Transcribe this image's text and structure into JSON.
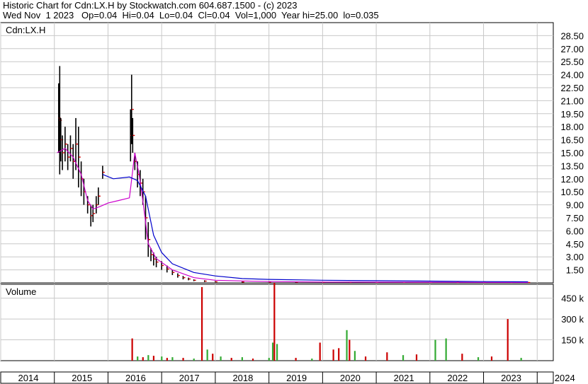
{
  "header": {
    "line1": "Historic Chart for Cdn:LX.H by Stockwatch.com 604.687.1500 - (c) 2023",
    "line2": "Wed Nov  1 2023   Op=0.04  Hi=0.04  Lo=0.04  Cl=0.04  Vol=1,000  Year hi=25.00  lo=0.035"
  },
  "colors": {
    "price_bar": "#000000",
    "close_tick": "#cc0000",
    "ma_short": "#cc00cc",
    "ma_long": "#0000cc",
    "volume_up": "#33aa33",
    "volume_down": "#cc0000",
    "grid": "#c8c8c8"
  },
  "chart_data": [
    {
      "type": "line",
      "title": "Cdn:LX.H",
      "x_range": [
        2014.0,
        2024.3
      ],
      "ylim": [
        0,
        30
      ],
      "y_ticks": [
        "1.50",
        "3.00",
        "4.50",
        "6.00",
        "7.50",
        "9.00",
        "10.50",
        "12.00",
        "13.50",
        "15.00",
        "16.50",
        "18.00",
        "19.50",
        "21.00",
        "22.50",
        "24.00",
        "25.50",
        "27.00",
        "28.50"
      ],
      "grid": true,
      "price_bars": [
        [
          2015.08,
          15,
          23
        ],
        [
          2015.1,
          12.5,
          25
        ],
        [
          2015.12,
          14,
          19
        ],
        [
          2015.15,
          13,
          17
        ],
        [
          2015.2,
          14,
          18
        ],
        [
          2015.25,
          13,
          16
        ],
        [
          2015.3,
          14,
          17
        ],
        [
          2015.35,
          12,
          16
        ],
        [
          2015.4,
          13,
          19
        ],
        [
          2015.45,
          11,
          18
        ],
        [
          2015.5,
          10,
          14
        ],
        [
          2015.55,
          9,
          12
        ],
        [
          2015.62,
          8,
          10
        ],
        [
          2015.68,
          6.5,
          9
        ],
        [
          2015.72,
          7,
          9
        ],
        [
          2015.78,
          8,
          10
        ],
        [
          2015.82,
          9,
          11
        ],
        [
          2015.9,
          12,
          13.5
        ],
        [
          2016.42,
          14,
          20
        ],
        [
          2016.44,
          16,
          24
        ],
        [
          2016.46,
          15,
          19
        ],
        [
          2016.5,
          13,
          15
        ],
        [
          2016.55,
          11,
          14
        ],
        [
          2016.6,
          10,
          13
        ],
        [
          2016.65,
          9,
          12
        ],
        [
          2016.7,
          5,
          10
        ],
        [
          2016.75,
          3,
          7
        ],
        [
          2016.8,
          2.5,
          4
        ],
        [
          2016.85,
          2,
          3.5
        ],
        [
          2016.9,
          1.8,
          3
        ],
        [
          2017.0,
          1.5,
          2.5
        ],
        [
          2017.1,
          1.2,
          2
        ],
        [
          2017.2,
          0.9,
          1.5
        ],
        [
          2017.3,
          0.6,
          1.1
        ],
        [
          2017.4,
          0.4,
          0.8
        ],
        [
          2017.5,
          0.3,
          0.6
        ],
        [
          2017.6,
          0.2,
          0.4
        ],
        [
          2017.8,
          0.1,
          0.3
        ],
        [
          2018.0,
          0.05,
          0.2
        ],
        [
          2018.5,
          0.05,
          0.15
        ],
        [
          2019.0,
          0.04,
          0.12
        ],
        [
          2019.5,
          0.04,
          0.12
        ],
        [
          2020.0,
          0.04,
          0.1
        ],
        [
          2020.5,
          0.04,
          0.1
        ],
        [
          2021.0,
          0.04,
          0.08
        ],
        [
          2021.5,
          0.04,
          0.08
        ],
        [
          2022.0,
          0.04,
          0.08
        ],
        [
          2022.5,
          0.04,
          0.06
        ],
        [
          2023.0,
          0.04,
          0.06
        ],
        [
          2023.5,
          0.035,
          0.06
        ],
        [
          2023.83,
          0.04,
          0.04
        ]
      ],
      "series": [
        {
          "x": [
            2015.05,
            2015.2,
            2015.35,
            2015.5,
            2015.62,
            2015.72,
            2015.85,
            2016.0,
            2016.2,
            2016.4,
            2016.5,
            2016.58,
            2016.66,
            2016.75,
            2016.9,
            2017.2,
            2017.6,
            2018.0,
            2019.0,
            2020.0,
            2021.0,
            2022.0,
            2023.0,
            2023.83
          ],
          "y": [
            15.0,
            15.5,
            14.5,
            12.5,
            9.5,
            8.5,
            8.8,
            9.2,
            9.5,
            9.8,
            15.0,
            12.5,
            9.0,
            4.5,
            2.8,
            1.5,
            0.6,
            0.3,
            0.15,
            0.1,
            0.08,
            0.07,
            0.06,
            0.05
          ]
        },
        {
          "x": [
            2015.9,
            2016.1,
            2016.4,
            2016.55,
            2016.7,
            2016.85,
            2017.0,
            2017.2,
            2017.6,
            2018.0,
            2018.5,
            2019.0,
            2020.0,
            2021.0,
            2022.0,
            2023.0,
            2023.83
          ],
          "y": [
            12.5,
            12.0,
            12.2,
            11.8,
            10.0,
            5.5,
            3.5,
            2.2,
            1.2,
            0.8,
            0.5,
            0.4,
            0.3,
            0.25,
            0.2,
            0.15,
            0.12
          ]
        }
      ]
    },
    {
      "type": "bar",
      "title": "Volume",
      "ylim": [
        0,
        550
      ],
      "y_ticks": [
        "150 k",
        "300 k",
        "450 k"
      ],
      "x_ticks": [
        "2014",
        "2015",
        "2016",
        "2017",
        "2018",
        "2019",
        "2020",
        "2021",
        "2022",
        "2023",
        "2024"
      ],
      "volume_bars": [
        [
          2016.45,
          160,
          "down"
        ],
        [
          2016.55,
          30,
          "up"
        ],
        [
          2016.65,
          25,
          "down"
        ],
        [
          2016.75,
          40,
          "up"
        ],
        [
          2016.85,
          35,
          "down"
        ],
        [
          2017.0,
          30,
          "up"
        ],
        [
          2017.1,
          20,
          "down"
        ],
        [
          2017.2,
          25,
          "up"
        ],
        [
          2017.4,
          20,
          "down"
        ],
        [
          2017.6,
          15,
          "up"
        ],
        [
          2017.75,
          530,
          "down"
        ],
        [
          2017.85,
          80,
          "up"
        ],
        [
          2017.95,
          50,
          "down"
        ],
        [
          2018.1,
          30,
          "up"
        ],
        [
          2018.3,
          20,
          "down"
        ],
        [
          2018.5,
          25,
          "up"
        ],
        [
          2018.7,
          15,
          "down"
        ],
        [
          2019.0,
          20,
          "up"
        ],
        [
          2019.07,
          130,
          "up"
        ],
        [
          2019.1,
          560,
          "down"
        ],
        [
          2019.15,
          120,
          "up"
        ],
        [
          2019.5,
          20,
          "down"
        ],
        [
          2019.8,
          15,
          "up"
        ],
        [
          2019.95,
          130,
          "down"
        ],
        [
          2020.2,
          80,
          "down"
        ],
        [
          2020.3,
          90,
          "down"
        ],
        [
          2020.45,
          220,
          "up"
        ],
        [
          2020.5,
          150,
          "down"
        ],
        [
          2020.6,
          70,
          "up"
        ],
        [
          2020.8,
          30,
          "down"
        ],
        [
          2021.2,
          60,
          "down"
        ],
        [
          2021.5,
          40,
          "up"
        ],
        [
          2021.75,
          45,
          "down"
        ],
        [
          2022.1,
          150,
          "up"
        ],
        [
          2022.3,
          160,
          "up"
        ],
        [
          2022.6,
          50,
          "down"
        ],
        [
          2022.9,
          25,
          "up"
        ],
        [
          2023.15,
          30,
          "down"
        ],
        [
          2023.45,
          300,
          "down"
        ],
        [
          2023.7,
          20,
          "up"
        ]
      ]
    }
  ]
}
